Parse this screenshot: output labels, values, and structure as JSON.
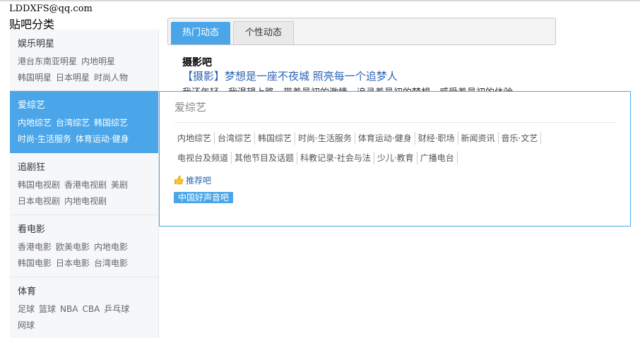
{
  "user": {
    "email": "LDDXFS@qq.com"
  },
  "sidebar": {
    "title": "贴吧分类",
    "categories": [
      {
        "title": "娱乐明星",
        "lines": [
          [
            "港台东南亚明星",
            "内地明星"
          ],
          [
            "韩国明星",
            "日本明星",
            "时尚人物"
          ]
        ]
      },
      {
        "title": "爱综艺",
        "lines": [
          [
            "内地综艺",
            "台湾综艺",
            "韩国综艺"
          ],
          [
            "时尚·生活服务",
            "体育运动·健身"
          ]
        ]
      },
      {
        "title": "追剧狂",
        "lines": [
          [
            "韩国电视剧",
            "香港电视剧",
            "美剧"
          ],
          [
            "日本电视剧",
            "内地电视剧"
          ]
        ]
      },
      {
        "title": "看电影",
        "lines": [
          [
            "香港电影",
            "欧美电影",
            "内地电影"
          ],
          [
            "韩国电影",
            "日本电影",
            "台湾电影"
          ]
        ]
      },
      {
        "title": "体育",
        "lines": [
          [
            "足球",
            "篮球",
            "NBA",
            "CBA",
            "乒乓球"
          ],
          [
            "网球"
          ]
        ]
      }
    ]
  },
  "tabs": {
    "hot": "热门动态",
    "personal": "个性动态"
  },
  "feed": {
    "forum": "摄影吧",
    "title": "【摄影】梦想是一座不夜城 照亮每一个追梦人",
    "desc": "我还年轻，我渴望上路，带着最初的激情，追寻着最初的梦想，感受着最初的体验"
  },
  "popup": {
    "title": "爱综艺",
    "tags_row1": [
      "内地综艺",
      "台湾综艺",
      "韩国综艺",
      "时尚·生活服务",
      "体育运动·健身",
      "财经·职场",
      "新闻资讯",
      "音乐·文艺"
    ],
    "tags_row2": [
      "电视台及频道",
      "其他节目及话题",
      "科教记录·社会与法",
      "少儿·教育",
      "广播电台"
    ],
    "recommend_label": "推荐吧",
    "recommend_forum": "中国好声音吧"
  },
  "colors": {
    "accent": "#4aa6e8",
    "link": "#2d64b3"
  },
  "icons": {
    "recommend": "thumbs-up-icon"
  }
}
